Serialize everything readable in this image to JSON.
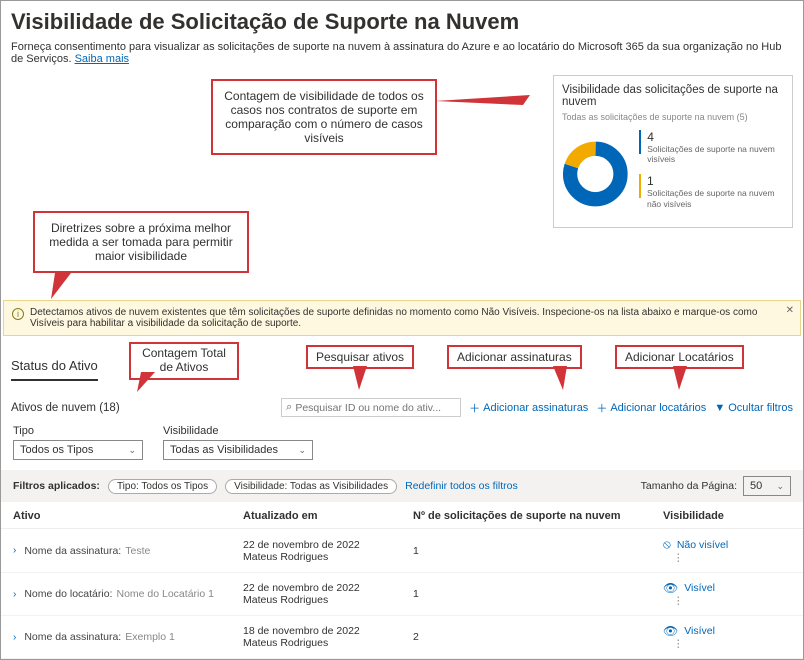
{
  "header": {
    "title": "Visibilidade de Solicitação de Suporte na Nuvem",
    "subtitle": "Forneça consentimento para visualizar as solicitações de suporte na nuvem à assinatura do Azure e ao locatário do Microsoft 365 da sua organização no Hub de Serviços.",
    "learn_more": "Saiba mais"
  },
  "callouts": {
    "count": "Contagem de visibilidade de todos os casos nos contratos de suporte em comparação com o número de casos visíveis",
    "guidance": "Diretrizes sobre a próxima melhor medida a ser tomada para permitir maior visibilidade",
    "total_assets": "Contagem Total de Ativos",
    "search_assets": "Pesquisar ativos",
    "add_subs": "Adicionar assinaturas",
    "add_tenants": "Adicionar Locatários"
  },
  "chart": {
    "title": "Visibilidade das solicitações de suporte na nuvem",
    "subtitle": "Todas as solicitações de suporte na nuvem (5)",
    "legend": [
      {
        "value": "4",
        "label": "Solicitações de suporte na nuvem visíveis",
        "color": "#0067b8"
      },
      {
        "value": "1",
        "label": "Solicitações de suporte na nuvem não visíveis",
        "color": "#f2a900"
      }
    ]
  },
  "chart_data": {
    "type": "pie",
    "title": "Visibilidade das solicitações de suporte na nuvem",
    "series": [
      {
        "name": "Solicitações de suporte na nuvem visíveis",
        "value": 4,
        "color": "#0067b8"
      },
      {
        "name": "Solicitações de suporte na nuvem não visíveis",
        "value": 1,
        "color": "#f2a900"
      }
    ],
    "total": 5
  },
  "notice": "Detectamos ativos de nuvem existentes que têm solicitações de suporte definidas no momento como Não Visíveis. Inspecione-os na lista abaixo e marque-os como Visíveis para habilitar a visibilidade da solicitação de suporte.",
  "tab": "Status do Ativo",
  "toolbar": {
    "count": "Ativos de nuvem (18)",
    "search_placeholder": "Pesquisar ID ou nome do ativ...",
    "add_subs": "Adicionar assinaturas",
    "add_tenants": "Adicionar locatários",
    "hide_filters": "Ocultar filtros"
  },
  "filters": {
    "type_label": "Tipo",
    "type_value": "Todos os Tipos",
    "vis_label": "Visibilidade",
    "vis_value": "Todas as Visibilidades"
  },
  "applied": {
    "label": "Filtros aplicados:",
    "chip1": "Tipo: Todos os Tipos",
    "chip2": "Visibilidade: Todas as Visibilidades",
    "reset": "Redefinir todos os filtros",
    "page_size_label": "Tamanho da Página:",
    "page_size_value": "50"
  },
  "columns": {
    "asset": "Ativo",
    "updated": "Atualizado em",
    "requests": "Nº de solicitações de suporte na nuvem",
    "visibility": "Visibilidade"
  },
  "rows": [
    {
      "type_label": "Nome da assinatura:",
      "name": "Teste",
      "updated_date": "22 de novembro de 2022",
      "updated_by": "Mateus Rodrigues",
      "requests": "1",
      "visibility": "Não visível",
      "visible": false
    },
    {
      "type_label": "Nome do locatário:",
      "name": "Nome do Locatário 1",
      "updated_date": "22 de novembro de 2022",
      "updated_by": "Mateus Rodrigues",
      "requests": "1",
      "visibility": "Visível",
      "visible": true
    },
    {
      "type_label": "Nome da assinatura:",
      "name": "Exemplo 1",
      "updated_date": "18 de novembro de 2022",
      "updated_by": "Mateus Rodrigues",
      "requests": "2",
      "visibility": "Visível",
      "visible": true
    }
  ]
}
